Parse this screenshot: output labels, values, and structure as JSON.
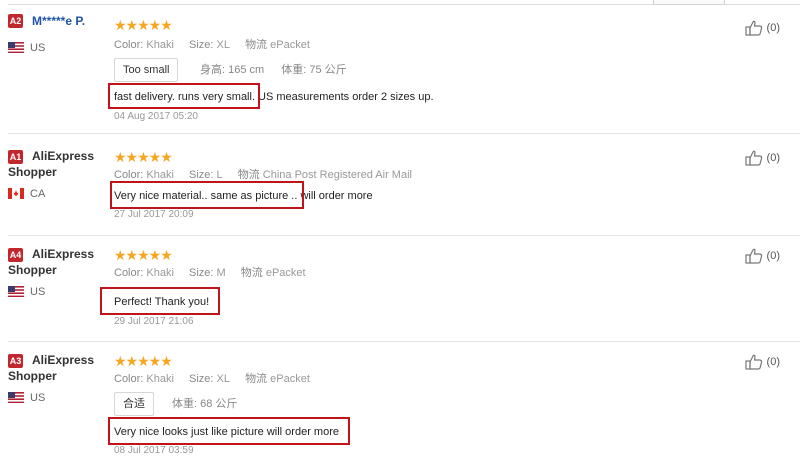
{
  "colors": {
    "badge": "#c1272d",
    "stars": "#f5a623",
    "highlight": "#c0141b",
    "masked_name": "#2154a5"
  },
  "reviews": [
    {
      "badge": "A2",
      "buyer_name": "M*****e P.",
      "country": "US",
      "flag": "us-flag-icon",
      "stars": "★★★★★",
      "color_label": "Color:",
      "color_value": "Khaki",
      "size_label": "Size:",
      "size_value": "XL",
      "shipping_label": "物流",
      "shipping_value": "ePacket",
      "fit_label": "Too small",
      "height_label": "身高:",
      "height_value": "165 cm",
      "weight_label": "体重:",
      "weight_value": "75 公斤",
      "text": "fast delivery. runs very small. US measurements order 2 sizes up.",
      "highlighted": "fast delivery. runs very small.",
      "date": "04 Aug 2017 05:20",
      "helpful": "(0)"
    },
    {
      "badge": "A1",
      "buyer_name_l1": "AliExpress",
      "buyer_name_l2": "Shopper",
      "country": "CA",
      "flag": "ca-flag-icon",
      "stars": "★★★★★",
      "color_label": "Color:",
      "color_value": "Khaki",
      "size_label": "Size:",
      "size_value": "L",
      "shipping_label": "物流",
      "shipping_value": "China Post Registered Air Mail",
      "text": "Very nice material.. same as picture .. will order more",
      "highlighted": "Very nice material.. same as picture ..",
      "date": "27 Jul 2017 20:09",
      "helpful": "(0)"
    },
    {
      "badge": "A4",
      "buyer_name_l1": "AliExpress",
      "buyer_name_l2": "Shopper",
      "country": "US",
      "flag": "us-flag-icon",
      "stars": "★★★★★",
      "color_label": "Color:",
      "color_value": "Khaki",
      "size_label": "Size:",
      "size_value": "M",
      "shipping_label": "物流",
      "shipping_value": "ePacket",
      "text": "Perfect! Thank you!",
      "date": "29 Jul 2017 21:06",
      "helpful": "(0)"
    },
    {
      "badge": "A3",
      "buyer_name_l1": "AliExpress",
      "buyer_name_l2": "Shopper",
      "country": "US",
      "flag": "us-flag-icon",
      "stars": "★★★★★",
      "color_label": "Color:",
      "color_value": "Khaki",
      "size_label": "Size:",
      "size_value": "XL",
      "shipping_label": "物流",
      "shipping_value": "ePacket",
      "fit_label": "合适",
      "weight_label": "体重:",
      "weight_value": "68 公斤",
      "text": "Very nice looks just like picture will order more",
      "date": "08 Jul 2017 03:59",
      "helpful": "(0)"
    }
  ]
}
